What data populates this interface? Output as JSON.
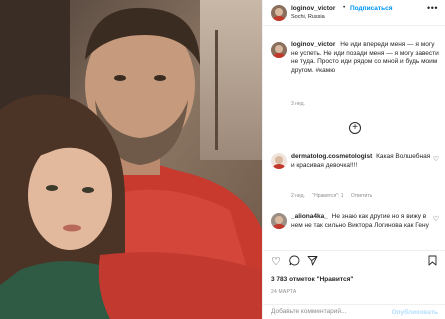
{
  "post": {
    "username": "loginov_victor",
    "follow_label": "Подписаться",
    "location": "Sochi, Russia",
    "more_icon": "more-dots-icon"
  },
  "caption": {
    "username": "loginov_victor",
    "text": "Не иди впереди меня — я могу не успеть. Не иди позади меня — я могу завести не туда. Просто иди рядом со мной и будь моим другом. #камю",
    "time": "3 нед."
  },
  "load_more_icon": "plus-circle-icon",
  "comments": [
    {
      "username": "dermatolog.cosmetologist",
      "text": "Какая Волшебная и красивая девочка!!!!",
      "meta": [
        "2 нед.",
        "\"Нравится\": 1",
        "Ответить"
      ]
    },
    {
      "username": "_aliona4ka_",
      "text": "Не знаю как другие но я вижу в нем не так сильно Виктора Логинова как Гену",
      "meta": []
    }
  ],
  "actions": {
    "icons": [
      "heart-icon",
      "comment-icon",
      "share-icon",
      "bookmark-icon"
    ]
  },
  "likes": "3 783 отметок \"Нравится\"",
  "date": "24 МАРТА",
  "add_comment": {
    "placeholder": "Добавьте комментарий...",
    "publish_label": "Опубликовать"
  },
  "colors": {
    "accent": "#0095f6",
    "publish_disabled": "#b2dffc",
    "muted": "#8e8e8e"
  }
}
